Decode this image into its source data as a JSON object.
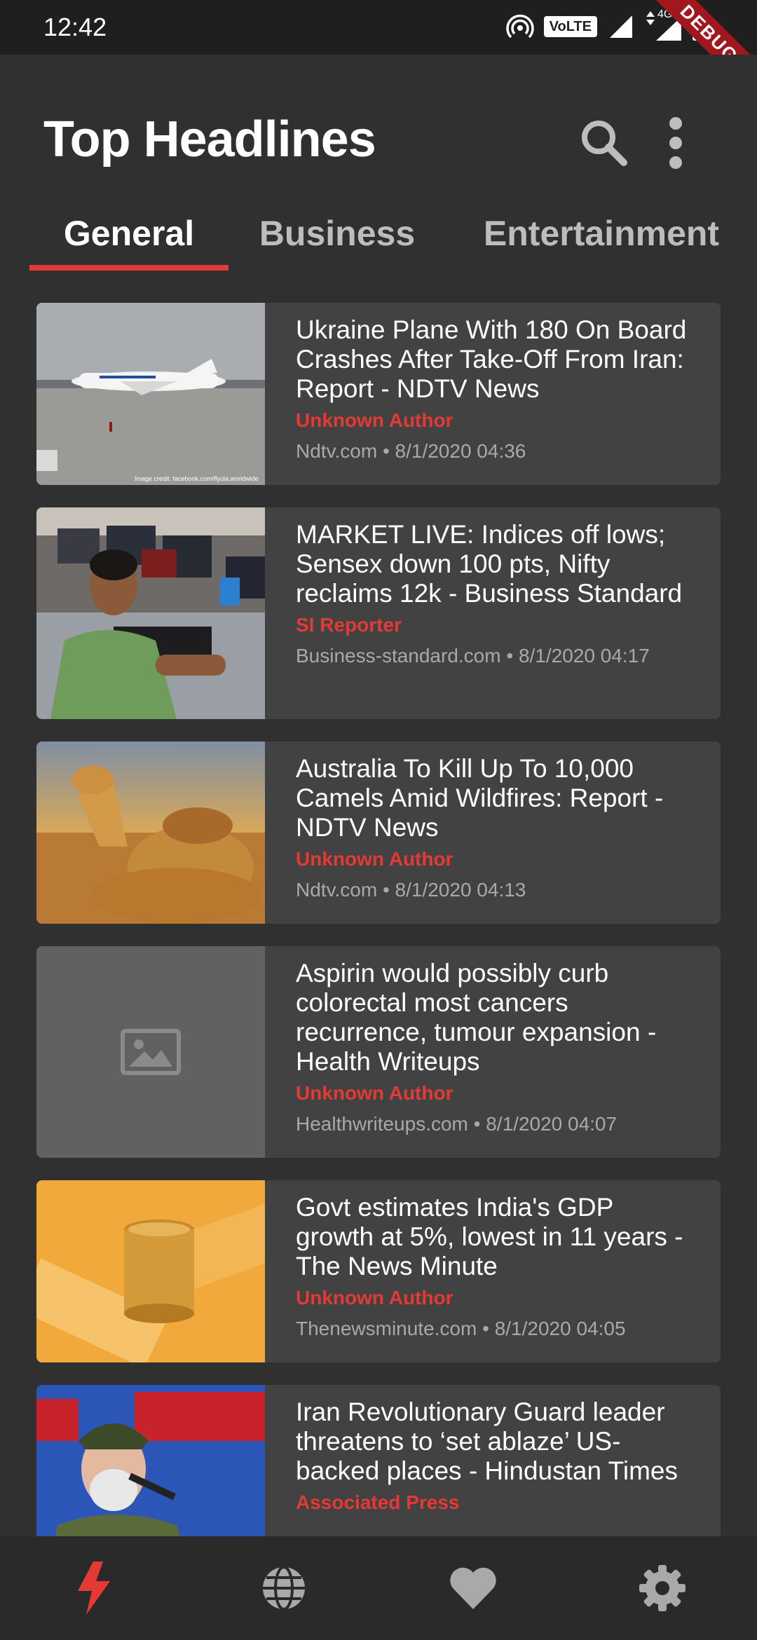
{
  "status_bar": {
    "time": "12:42",
    "volte": "VoLTE",
    "network": "4G",
    "debug_label": "DEBUG"
  },
  "app_bar": {
    "title": "Top Headlines"
  },
  "tabs": [
    {
      "label": "General",
      "active": true
    },
    {
      "label": "Business",
      "active": false
    },
    {
      "label": "Entertainment",
      "active": false
    }
  ],
  "articles": [
    {
      "title": "Ukraine Plane With 180 On Board Crashes After Take-Off From Iran: Report - NDTV News",
      "author": "Unknown Author",
      "meta": "Ndtv.com • 8/1/2020 04:36",
      "image_credit": "Image credit: facebook.com/flyuia.worldwide"
    },
    {
      "title": "MARKET LIVE: Indices off lows; Sensex down 100 pts, Nifty reclaims 12k - Business Standard",
      "author": "SI Reporter",
      "meta": "Business-standard.com • 8/1/2020 04:17"
    },
    {
      "title": "Australia To Kill Up To 10,000 Camels Amid Wildfires: Report - NDTV News",
      "author": "Unknown Author",
      "meta": "Ndtv.com • 8/1/2020 04:13"
    },
    {
      "title": "Aspirin would possibly curb colorectal most cancers recurrence, tumour expansion - Health Writeups",
      "author": "Unknown Author",
      "meta": "Healthwriteups.com • 8/1/2020 04:07"
    },
    {
      "title": "Govt estimates India's GDP growth at 5%, lowest in 11 years - The News Minute",
      "author": "Unknown Author",
      "meta": "Thenewsminute.com • 8/1/2020 04:05"
    },
    {
      "title": "Iran Revolutionary Guard leader threatens to ‘set ablaze’ US-backed places - Hindustan Times",
      "author": "Associated Press",
      "meta": ""
    }
  ],
  "bottom_nav": [
    {
      "icon": "flash-icon",
      "active": true
    },
    {
      "icon": "globe-icon",
      "active": false
    },
    {
      "icon": "heart-icon",
      "active": false
    },
    {
      "icon": "settings-icon",
      "active": false
    }
  ],
  "colors": {
    "accent": "#e53935",
    "background": "#303030",
    "card": "#424242"
  }
}
